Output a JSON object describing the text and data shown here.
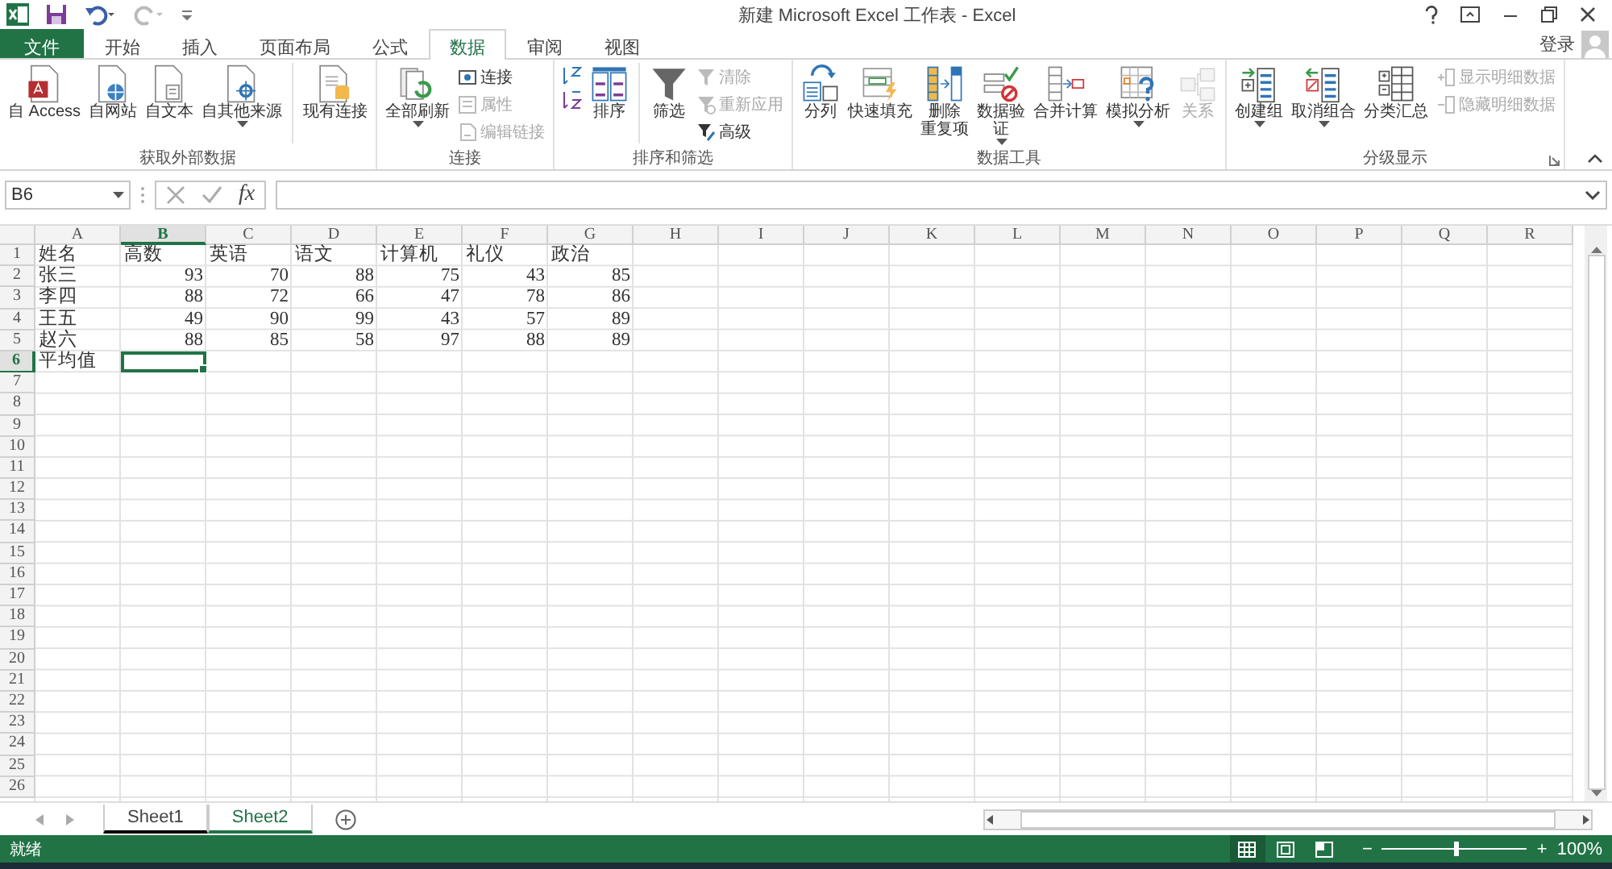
{
  "window": {
    "title": "新建 Microsoft Excel 工作表 - Excel"
  },
  "tabs": [
    {
      "label": "文件",
      "kind": "file",
      "selected": false
    },
    {
      "label": "开始",
      "kind": "tab",
      "selected": false
    },
    {
      "label": "插入",
      "kind": "tab",
      "selected": false
    },
    {
      "label": "页面布局",
      "kind": "tab",
      "selected": false
    },
    {
      "label": "公式",
      "kind": "tab",
      "selected": false
    },
    {
      "label": "数据",
      "kind": "tab",
      "selected": true
    },
    {
      "label": "审阅",
      "kind": "tab",
      "selected": false
    },
    {
      "label": "视图",
      "kind": "tab",
      "selected": false
    }
  ],
  "account": {
    "label": "登录"
  },
  "ribbon": {
    "groups": [
      {
        "label": "获取外部数据",
        "dialog_launcher": false,
        "items": [
          {
            "kind": "large",
            "label": "自 Access",
            "dropdown": false,
            "disabled": false
          },
          {
            "kind": "large",
            "label": "自网站",
            "dropdown": false,
            "disabled": false
          },
          {
            "kind": "large",
            "label": "自文本",
            "dropdown": false,
            "disabled": false
          },
          {
            "kind": "large",
            "label": "自其他来源",
            "dropdown": true,
            "disabled": false
          },
          {
            "kind": "separator"
          },
          {
            "kind": "large",
            "label": "现有连接",
            "dropdown": false,
            "disabled": false
          }
        ]
      },
      {
        "label": "连接",
        "dialog_launcher": false,
        "items": [
          {
            "kind": "large",
            "label": "全部刷新",
            "dropdown": true,
            "disabled": false
          },
          {
            "kind": "stack",
            "items": [
              {
                "label": "连接",
                "disabled": false
              },
              {
                "label": "属性",
                "disabled": true
              },
              {
                "label": "编辑链接",
                "disabled": true
              }
            ]
          }
        ]
      },
      {
        "label": "排序和筛选",
        "dialog_launcher": false,
        "items": [
          {
            "kind": "stack",
            "items": [
              {
                "disabled": false
              },
              {
                "disabled": false
              }
            ]
          },
          {
            "kind": "large",
            "label": "排序",
            "dropdown": false,
            "disabled": false
          },
          {
            "kind": "separator"
          },
          {
            "kind": "large",
            "label": "筛选",
            "dropdown": false,
            "disabled": false
          },
          {
            "kind": "stack",
            "items": [
              {
                "label": "清除",
                "disabled": true
              },
              {
                "label": "重新应用",
                "disabled": true
              },
              {
                "label": "高级",
                "disabled": false
              }
            ]
          }
        ]
      },
      {
        "label": "数据工具",
        "dialog_launcher": false,
        "items": [
          {
            "kind": "large",
            "label": "分列",
            "dropdown": false,
            "disabled": false
          },
          {
            "kind": "large",
            "label": "快速填充",
            "dropdown": false,
            "disabled": false
          },
          {
            "kind": "large",
            "label": [
              "删除",
              "重复项"
            ],
            "dropdown": false,
            "disabled": false
          },
          {
            "kind": "large",
            "label": [
              "数据验",
              "证"
            ],
            "dropdown": true,
            "disabled": false
          },
          {
            "kind": "large",
            "label": "合并计算",
            "dropdown": false,
            "disabled": false
          },
          {
            "kind": "large",
            "label": "模拟分析",
            "dropdown": true,
            "disabled": false
          },
          {
            "kind": "large",
            "label": "关系",
            "dropdown": false,
            "disabled": true
          }
        ]
      },
      {
        "label": "分级显示",
        "dialog_launcher": true,
        "items": [
          {
            "kind": "large",
            "label": "创建组",
            "dropdown": true,
            "disabled": false
          },
          {
            "kind": "large",
            "label": "取消组合",
            "dropdown": true,
            "disabled": false
          },
          {
            "kind": "large",
            "label": "分类汇总",
            "dropdown": false,
            "disabled": false
          },
          {
            "kind": "stack",
            "items": [
              {
                "label": "显示明细数据",
                "disabled": true
              },
              {
                "label": "隐藏明细数据",
                "disabled": true
              }
            ]
          }
        ]
      }
    ]
  },
  "formula_bar": {
    "name_box": "B6",
    "function_button": "fx"
  },
  "sheet": {
    "columns": [
      {
        "label": "A",
        "selected": false
      },
      {
        "label": "B",
        "selected": true
      },
      {
        "label": "C",
        "selected": false
      },
      {
        "label": "D",
        "selected": false
      },
      {
        "label": "E",
        "selected": false
      },
      {
        "label": "F",
        "selected": false
      },
      {
        "label": "G",
        "selected": false
      },
      {
        "label": "H",
        "selected": false
      },
      {
        "label": "I",
        "selected": false
      },
      {
        "label": "J",
        "selected": false
      },
      {
        "label": "K",
        "selected": false
      },
      {
        "label": "L",
        "selected": false
      },
      {
        "label": "M",
        "selected": false
      },
      {
        "label": "N",
        "selected": false
      },
      {
        "label": "O",
        "selected": false
      },
      {
        "label": "P",
        "selected": false
      },
      {
        "label": "Q",
        "selected": false
      },
      {
        "label": "R",
        "selected": false
      }
    ],
    "rows": [
      {
        "label": "1",
        "selected": false,
        "kind": "header",
        "cells": [
          "姓名",
          "高数",
          "英语",
          "语文",
          "计算机",
          "礼仪",
          "政治"
        ]
      },
      {
        "label": "2",
        "selected": false,
        "kind": "record",
        "cells": [
          "张三",
          "93",
          "70",
          "88",
          "75",
          "43",
          "85"
        ]
      },
      {
        "label": "3",
        "selected": false,
        "kind": "record",
        "cells": [
          "李四",
          "88",
          "72",
          "66",
          "47",
          "78",
          "86"
        ]
      },
      {
        "label": "4",
        "selected": false,
        "kind": "record",
        "cells": [
          "王五",
          "49",
          "90",
          "99",
          "43",
          "57",
          "89"
        ]
      },
      {
        "label": "5",
        "selected": false,
        "kind": "record",
        "cells": [
          "赵六",
          "88",
          "85",
          "58",
          "97",
          "88",
          "89"
        ]
      },
      {
        "label": "6",
        "selected": true,
        "kind": "header",
        "cells": [
          "平均值"
        ]
      },
      {
        "label": "7",
        "selected": false
      },
      {
        "label": "8",
        "selected": false
      },
      {
        "label": "9",
        "selected": false
      },
      {
        "label": "10",
        "selected": false
      },
      {
        "label": "11",
        "selected": false
      },
      {
        "label": "12",
        "selected": false
      },
      {
        "label": "13",
        "selected": false
      },
      {
        "label": "14",
        "selected": false
      },
      {
        "label": "15",
        "selected": false
      },
      {
        "label": "16",
        "selected": false
      },
      {
        "label": "17",
        "selected": false
      },
      {
        "label": "18",
        "selected": false
      },
      {
        "label": "19",
        "selected": false
      },
      {
        "label": "20",
        "selected": false
      },
      {
        "label": "21",
        "selected": false
      },
      {
        "label": "22",
        "selected": false
      },
      {
        "label": "23",
        "selected": false
      },
      {
        "label": "24",
        "selected": false
      },
      {
        "label": "25",
        "selected": false
      },
      {
        "label": "26",
        "selected": false
      }
    ]
  },
  "sheet_tabs": [
    {
      "label": "Sheet1",
      "selected": false
    },
    {
      "label": "Sheet2",
      "selected": true
    }
  ],
  "status_bar": {
    "text": "就绪",
    "views": [
      {
        "selected": true
      },
      {
        "selected": false
      },
      {
        "selected": false
      }
    ],
    "zoom": {
      "minus": "−",
      "plus": "+",
      "level": 0.5,
      "reading": "100%"
    }
  }
}
